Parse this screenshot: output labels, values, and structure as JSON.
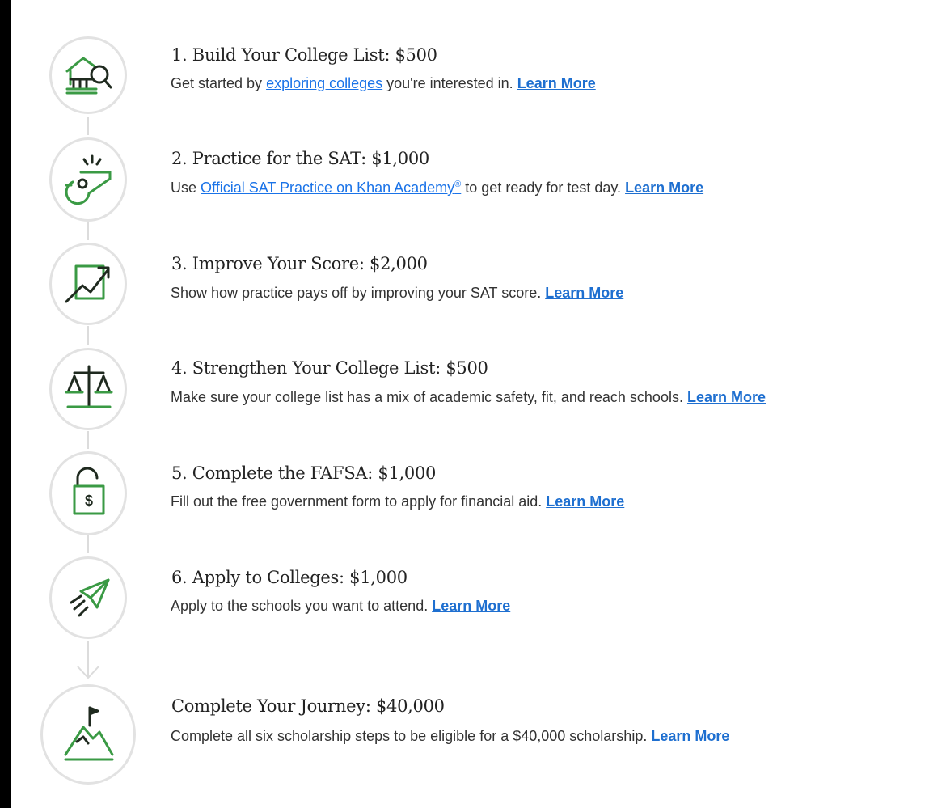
{
  "colors": {
    "accent_green": "#3a9a44",
    "link_blue": "#1a73e8",
    "ring_gray": "#e2e2e2"
  },
  "steps": [
    {
      "icon": "college-search-icon",
      "title": "1. Build Your College List: $500",
      "pre": "Get started by ",
      "link": "exploring colleges",
      "post": " you're interested in. ",
      "learn": "Learn More"
    },
    {
      "icon": "whistle-icon",
      "title": "2. Practice for the SAT: $1,000",
      "pre": "Use ",
      "link": "Official SAT Practice on Khan Academy",
      "link_sup": "®",
      "post": " to get ready for test day. ",
      "learn": "Learn More"
    },
    {
      "icon": "trend-up-chart-icon",
      "title": "3. Improve Your Score: $2,000",
      "text": "Show how practice pays off by improving your SAT score. ",
      "learn": "Learn More"
    },
    {
      "icon": "balance-scale-icon",
      "title": "4. Strengthen Your College List: $500",
      "text": "Make sure your college list has a mix of academic safety, fit, and reach schools. ",
      "learn": "Learn More"
    },
    {
      "icon": "unlocked-dollar-lock-icon",
      "title": "5. Complete the FAFSA: $1,000",
      "text": "Fill out the free government form to apply for financial aid. ",
      "learn": "Learn More"
    },
    {
      "icon": "paper-plane-icon",
      "title": "6. Apply to Colleges: $1,000",
      "text": "Apply to the schools you want to attend. ",
      "learn": "Learn More"
    },
    {
      "icon": "mountain-flag-icon",
      "title": "Complete Your Journey: $40,000",
      "text": "Complete all six scholarship steps to be eligible for a $40,000 scholarship. ",
      "learn": "Learn More"
    }
  ]
}
